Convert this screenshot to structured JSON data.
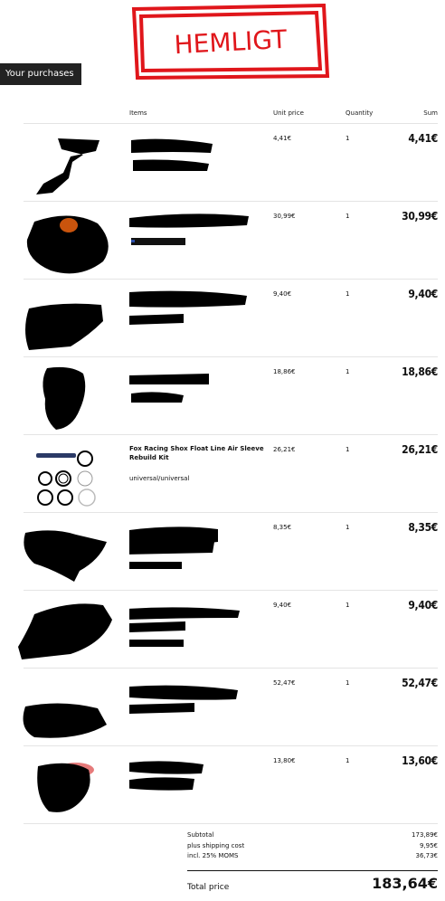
{
  "stamp": {
    "text": "HEMLIGT"
  },
  "tab": {
    "label": "Your purchases"
  },
  "table": {
    "headers": {
      "items": "Items",
      "unit_price": "Unit price",
      "quantity": "Quantity",
      "sum": "Sum"
    },
    "rows": [
      {
        "unit_price": "4,41€",
        "quantity": "1",
        "sum": "4,41€"
      },
      {
        "unit_price": "30,99€",
        "quantity": "1",
        "sum": "30,99€"
      },
      {
        "unit_price": "9,40€",
        "quantity": "1",
        "sum": "9,40€"
      },
      {
        "unit_price": "18,86€",
        "quantity": "1",
        "sum": "18,86€"
      },
      {
        "name": "Fox Racing Shox Float Line Air Sleeve Rebuild Kit",
        "variant": "universal/universal",
        "unit_price": "26,21€",
        "quantity": "1",
        "sum": "26,21€"
      },
      {
        "unit_price": "8,35€",
        "quantity": "1",
        "sum": "8,35€"
      },
      {
        "unit_price": "9,40€",
        "quantity": "1",
        "sum": "9,40€"
      },
      {
        "unit_price": "52,47€",
        "quantity": "1",
        "sum": "52,47€"
      },
      {
        "unit_price": "13,80€",
        "quantity": "1",
        "sum": "13,60€"
      }
    ]
  },
  "totals": {
    "subtotal_label": "Subtotal",
    "subtotal": "173,89€",
    "shipping_label": "plus shipping cost",
    "shipping": "9,95€",
    "vat_label": "incl. 25% MOMS",
    "vat": "36,73€",
    "total_label": "Total price",
    "total": "183,64€"
  },
  "colors": {
    "stamp": "#e0161b",
    "tab_bg": "#222222",
    "redaction": "#000000"
  }
}
